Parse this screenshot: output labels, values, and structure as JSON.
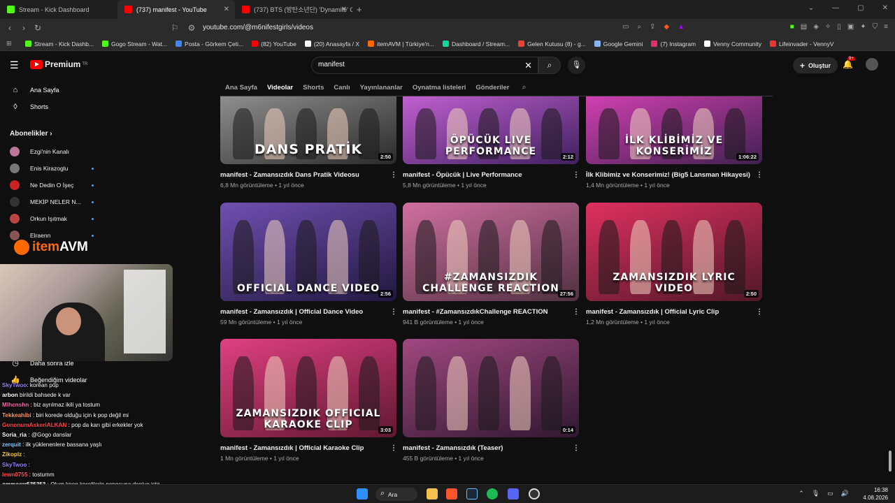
{
  "browser": {
    "tabs": [
      {
        "title": "Stream - Kick Dashboard",
        "color": "#53fc18"
      },
      {
        "title": "(737) manifest - YouTube",
        "color": "#ff0000",
        "active": true
      },
      {
        "title": "(737) BTS (방탄소년단) 'Dynamite' Of",
        "color": "#ff0000"
      }
    ],
    "url": "youtube.com/@m6nifestgirls/videos",
    "bookmarks": [
      {
        "label": "Stream - Kick Dashb...",
        "color": "#53fc18"
      },
      {
        "label": "Gogo Stream - Wat...",
        "color": "#53fc18"
      },
      {
        "label": "Posta - Görkem Çeti...",
        "color": "#4285f4"
      },
      {
        "label": "(82) YouTube",
        "color": "#ff0000"
      },
      {
        "label": "(20) Anasayfa / X",
        "color": "#ffffff"
      },
      {
        "label": "itemAVM | Türkiye'n...",
        "color": "#ff6a00"
      },
      {
        "label": "Dashboard / Stream...",
        "color": "#0fd9a0"
      },
      {
        "label": "Gelen Kutusu (8) - g...",
        "color": "#ea4335"
      },
      {
        "label": "Google Gemini",
        "color": "#8ab4f8"
      },
      {
        "label": "(7) Instagram",
        "color": "#e1306c"
      },
      {
        "label": "Venny Community",
        "color": "#ffffff"
      },
      {
        "label": "Lifeinvader - VennyV",
        "color": "#e33"
      }
    ]
  },
  "header": {
    "logo": "Premium",
    "logo_sup": "TR",
    "search_value": "manifest",
    "create_label": "Oluştur",
    "notif_badge": "9+"
  },
  "channel_tabs": [
    "Ana Sayfa",
    "Videolar",
    "Shorts",
    "Canlı",
    "Yayınlananlar",
    "Oynatma listeleri",
    "Gönderiler"
  ],
  "sidebar": {
    "items": [
      {
        "label": "Ana Sayfa",
        "icon": "home-icon"
      },
      {
        "label": "Shorts",
        "icon": "shorts-icon"
      }
    ],
    "subs_heading": "Abonelikler",
    "subs": [
      {
        "label": "Ezgi'nin Kanalı",
        "color": "#b79",
        "live": false
      },
      {
        "label": "Enis Kirazoglu",
        "color": "#777",
        "live": true
      },
      {
        "label": "Ne Dedin O İşeç",
        "color": "#c22",
        "live": true
      },
      {
        "label": "MEKİP NELER N...",
        "color": "#333",
        "live": true
      },
      {
        "label": "Orkun Işıtmak",
        "color": "#b44",
        "live": true
      },
      {
        "label": "Elraenn",
        "color": "#855",
        "live": true
      }
    ],
    "lower": [
      {
        "label": "Daha sonra izle",
        "icon": "clock-icon"
      },
      {
        "label": "Beğendiğim videolar",
        "icon": "thumbs-up-icon"
      }
    ]
  },
  "videos": [
    {
      "title": "manifest - Zamansızdık Dans Pratik Videosu",
      "views": "6,8 Mn görüntüleme",
      "age": "1 yıl önce",
      "duration": "2:50",
      "overlay": "DANS PRATİK",
      "c1": "#8e8e8e",
      "c2": "#2a2a2a"
    },
    {
      "title": "manifest - Öpücük | Live Performance",
      "views": "5,8 Mn görüntüleme",
      "age": "1 yıl önce",
      "duration": "2:12",
      "overlay": "ÖPÜCÜK LIVE PERFORMANCE",
      "c1": "#c060d0",
      "c2": "#402060"
    },
    {
      "title": "İlk Klibimiz ve Konserimiz! (Big5 Lansman Hikayesi)",
      "views": "1,4 Mn görüntüleme",
      "age": "1 yıl önce",
      "duration": "1:06:22",
      "overlay": "İLK KLİBİMİZ VE KONSERİMİZ",
      "c1": "#d040b0",
      "c2": "#402050"
    },
    {
      "title": "manifest - Zamansızdık | Official Dance Video",
      "views": "59 Mn görüntüleme",
      "age": "1 yıl önce",
      "duration": "2:56",
      "overlay": "OFFICIAL DANCE VIDEO",
      "c1": "#7050b0",
      "c2": "#201840"
    },
    {
      "title": "manifest - #ZamansızdıkChallenge REACTION",
      "views": "941 B görüntüleme",
      "age": "1 yıl önce",
      "duration": "27:56",
      "overlay": "#ZAMANSIZDIK CHALLENGE REACTION",
      "c1": "#d070a0",
      "c2": "#503040"
    },
    {
      "title": "manifest - Zamansızdık | Official Lyric Clip",
      "views": "1,2 Mn görüntüleme",
      "age": "1 yıl önce",
      "duration": "2:50",
      "overlay": "ZAMANSIZDIK LYRIC VIDEO",
      "c1": "#e03060",
      "c2": "#501828"
    },
    {
      "title": "manifest - Zamansızdık | Official Karaoke Clip",
      "views": "1 Mn görüntüleme",
      "age": "1 yıl önce",
      "duration": "3:03",
      "overlay": "ZAMANSIZDIK OFFICIAL KARAOKE CLIP",
      "c1": "#e04080",
      "c2": "#601830"
    },
    {
      "title": "manifest - Zamansızdık (Teaser)",
      "views": "455 B görüntüleme",
      "age": "1 yıl önce",
      "duration": "0:14",
      "overlay": "",
      "c1": "#a04880",
      "c2": "#301830"
    }
  ],
  "overlay": {
    "brand_it": "item",
    "brand_rest": "AVM",
    "chat": [
      {
        "user": "SkyTwoo",
        "msg": ": korean pop",
        "color": "#9b7dff"
      },
      {
        "user": "arbon",
        "msg": " birildi bahsede k var",
        "color": "#ffffff"
      },
      {
        "user": "Mlhcnshn",
        "msg": " : biz ayrılmaz ikili ya tostum",
        "color": "#ff66aa"
      },
      {
        "user": "Tekkeahibi",
        "msg": " : biri korede olduğu için k pop değil mi",
        "color": "#ff9966"
      },
      {
        "user": "GononumAskeriALKAN",
        "msg": " : pop da karı gibi erkekler yok",
        "color": "#ff4444"
      },
      {
        "user": "Soria_ria",
        "msg": " : @Gogo danslar",
        "color": "#ffffff"
      },
      {
        "user": "zerquit",
        "msg": " : ilk yüklenenlere bassana yaşlı",
        "color": "#88ccff"
      },
      {
        "user": "Zikoplz",
        "msg": " : ",
        "color": "#ffcc33"
      },
      {
        "user": "SkyTwoo",
        "msg": " : ",
        "color": "#9b7dff"
      },
      {
        "user": "lewn0755",
        "msg": " : tostumm",
        "color": "#ff5555"
      },
      {
        "user": "ommeerr535353",
        "msg": " : Olum kpop korelilerin poposuna deniyo işte",
        "color": "#ffffff"
      }
    ]
  },
  "taskbar": {
    "search_label": "Ara",
    "time": "16:38",
    "date": "4.08.2026"
  }
}
